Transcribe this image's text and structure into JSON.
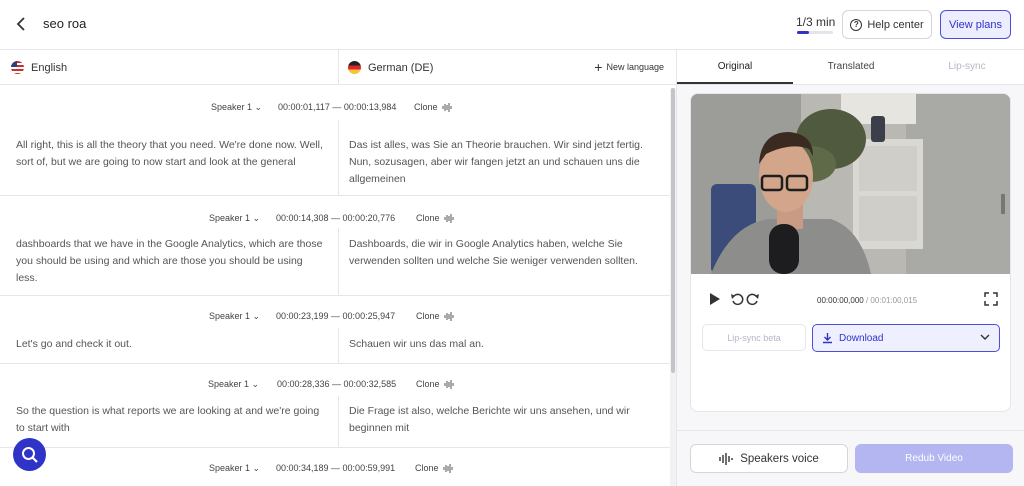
{
  "header": {
    "project_title": "seo roa",
    "usage_label": "1/3 min",
    "usage_progress": 0.33,
    "help_label": "Help center",
    "plans_label": "View plans"
  },
  "languages": {
    "source": "English",
    "source_flag": "us-flag-icon",
    "target": "German (DE)",
    "target_flag": "de-flag-icon",
    "new_language_label": "New language"
  },
  "segments": [
    {
      "speaker": "Speaker 1",
      "timecode": "00:00:01,117 — 00:00:13,984",
      "clone_label": "Clone",
      "source": "All right, this is all the theory that you need. We're done now. Well, sort of, but we are going to now start and look at the general",
      "target": "Das ist alles, was Sie an Theorie brauchen. Wir sind jetzt fertig. Nun, sozusagen, aber wir fangen jetzt an und schauen uns die allgemeinen"
    },
    {
      "speaker": "Speaker 1",
      "timecode": "00:00:14,308 — 00:00:20,776",
      "clone_label": "Clone",
      "source": "dashboards that we have in the Google Analytics, which are those you should be using and which are those you should be using less.",
      "target": "Dashboards, die wir in Google Analytics haben, welche Sie verwenden sollten und welche Sie weniger verwenden sollten."
    },
    {
      "speaker": "Speaker 1",
      "timecode": "00:00:23,199 — 00:00:25,947",
      "clone_label": "Clone",
      "source": "Let's go and check it out.",
      "target": "Schauen wir uns das mal an."
    },
    {
      "speaker": "Speaker 1",
      "timecode": "00:00:28,336 — 00:00:32,585",
      "clone_label": "Clone",
      "source": "So the question is what reports we are looking at and we're going to start with",
      "target": "Die Frage ist also, welche Berichte wir uns ansehen, und wir beginnen mit"
    },
    {
      "speaker": "Speaker 1",
      "timecode": "00:00:34,189 — 00:00:59,991",
      "clone_label": "Clone",
      "source": "",
      "target": ""
    }
  ],
  "preview": {
    "tabs": [
      "Original",
      "Translated",
      "Lip-sync"
    ],
    "active_tab": "Original",
    "current_time": "00:00:00,000",
    "duration": "/ 00:01:00,015",
    "lipsync_label": "Lip-sync beta",
    "download_label": "Download"
  },
  "footer": {
    "speakers_voice_label": "Speakers voice",
    "redub_label": "Redub Video"
  },
  "colors": {
    "accent": "#2f33c8",
    "accent_light": "#eceeff",
    "redub_disabled": "#b3b6f0"
  }
}
